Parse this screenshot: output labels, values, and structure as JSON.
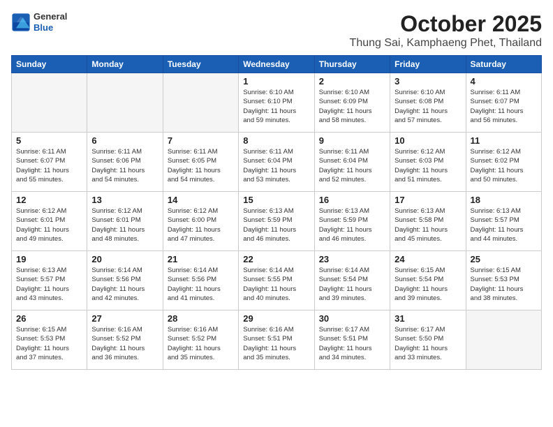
{
  "header": {
    "logo": {
      "general": "General",
      "blue": "Blue"
    },
    "month": "October 2025",
    "location": "Thung Sai, Kamphaeng Phet, Thailand"
  },
  "weekdays": [
    "Sunday",
    "Monday",
    "Tuesday",
    "Wednesday",
    "Thursday",
    "Friday",
    "Saturday"
  ],
  "weeks": [
    [
      {
        "day": "",
        "info": ""
      },
      {
        "day": "",
        "info": ""
      },
      {
        "day": "",
        "info": ""
      },
      {
        "day": "1",
        "info": "Sunrise: 6:10 AM\nSunset: 6:10 PM\nDaylight: 11 hours\nand 59 minutes."
      },
      {
        "day": "2",
        "info": "Sunrise: 6:10 AM\nSunset: 6:09 PM\nDaylight: 11 hours\nand 58 minutes."
      },
      {
        "day": "3",
        "info": "Sunrise: 6:10 AM\nSunset: 6:08 PM\nDaylight: 11 hours\nand 57 minutes."
      },
      {
        "day": "4",
        "info": "Sunrise: 6:11 AM\nSunset: 6:07 PM\nDaylight: 11 hours\nand 56 minutes."
      }
    ],
    [
      {
        "day": "5",
        "info": "Sunrise: 6:11 AM\nSunset: 6:07 PM\nDaylight: 11 hours\nand 55 minutes."
      },
      {
        "day": "6",
        "info": "Sunrise: 6:11 AM\nSunset: 6:06 PM\nDaylight: 11 hours\nand 54 minutes."
      },
      {
        "day": "7",
        "info": "Sunrise: 6:11 AM\nSunset: 6:05 PM\nDaylight: 11 hours\nand 54 minutes."
      },
      {
        "day": "8",
        "info": "Sunrise: 6:11 AM\nSunset: 6:04 PM\nDaylight: 11 hours\nand 53 minutes."
      },
      {
        "day": "9",
        "info": "Sunrise: 6:11 AM\nSunset: 6:04 PM\nDaylight: 11 hours\nand 52 minutes."
      },
      {
        "day": "10",
        "info": "Sunrise: 6:12 AM\nSunset: 6:03 PM\nDaylight: 11 hours\nand 51 minutes."
      },
      {
        "day": "11",
        "info": "Sunrise: 6:12 AM\nSunset: 6:02 PM\nDaylight: 11 hours\nand 50 minutes."
      }
    ],
    [
      {
        "day": "12",
        "info": "Sunrise: 6:12 AM\nSunset: 6:01 PM\nDaylight: 11 hours\nand 49 minutes."
      },
      {
        "day": "13",
        "info": "Sunrise: 6:12 AM\nSunset: 6:01 PM\nDaylight: 11 hours\nand 48 minutes."
      },
      {
        "day": "14",
        "info": "Sunrise: 6:12 AM\nSunset: 6:00 PM\nDaylight: 11 hours\nand 47 minutes."
      },
      {
        "day": "15",
        "info": "Sunrise: 6:13 AM\nSunset: 5:59 PM\nDaylight: 11 hours\nand 46 minutes."
      },
      {
        "day": "16",
        "info": "Sunrise: 6:13 AM\nSunset: 5:59 PM\nDaylight: 11 hours\nand 46 minutes."
      },
      {
        "day": "17",
        "info": "Sunrise: 6:13 AM\nSunset: 5:58 PM\nDaylight: 11 hours\nand 45 minutes."
      },
      {
        "day": "18",
        "info": "Sunrise: 6:13 AM\nSunset: 5:57 PM\nDaylight: 11 hours\nand 44 minutes."
      }
    ],
    [
      {
        "day": "19",
        "info": "Sunrise: 6:13 AM\nSunset: 5:57 PM\nDaylight: 11 hours\nand 43 minutes."
      },
      {
        "day": "20",
        "info": "Sunrise: 6:14 AM\nSunset: 5:56 PM\nDaylight: 11 hours\nand 42 minutes."
      },
      {
        "day": "21",
        "info": "Sunrise: 6:14 AM\nSunset: 5:56 PM\nDaylight: 11 hours\nand 41 minutes."
      },
      {
        "day": "22",
        "info": "Sunrise: 6:14 AM\nSunset: 5:55 PM\nDaylight: 11 hours\nand 40 minutes."
      },
      {
        "day": "23",
        "info": "Sunrise: 6:14 AM\nSunset: 5:54 PM\nDaylight: 11 hours\nand 39 minutes."
      },
      {
        "day": "24",
        "info": "Sunrise: 6:15 AM\nSunset: 5:54 PM\nDaylight: 11 hours\nand 39 minutes."
      },
      {
        "day": "25",
        "info": "Sunrise: 6:15 AM\nSunset: 5:53 PM\nDaylight: 11 hours\nand 38 minutes."
      }
    ],
    [
      {
        "day": "26",
        "info": "Sunrise: 6:15 AM\nSunset: 5:53 PM\nDaylight: 11 hours\nand 37 minutes."
      },
      {
        "day": "27",
        "info": "Sunrise: 6:16 AM\nSunset: 5:52 PM\nDaylight: 11 hours\nand 36 minutes."
      },
      {
        "day": "28",
        "info": "Sunrise: 6:16 AM\nSunset: 5:52 PM\nDaylight: 11 hours\nand 35 minutes."
      },
      {
        "day": "29",
        "info": "Sunrise: 6:16 AM\nSunset: 5:51 PM\nDaylight: 11 hours\nand 35 minutes."
      },
      {
        "day": "30",
        "info": "Sunrise: 6:17 AM\nSunset: 5:51 PM\nDaylight: 11 hours\nand 34 minutes."
      },
      {
        "day": "31",
        "info": "Sunrise: 6:17 AM\nSunset: 5:50 PM\nDaylight: 11 hours\nand 33 minutes."
      },
      {
        "day": "",
        "info": ""
      }
    ]
  ]
}
